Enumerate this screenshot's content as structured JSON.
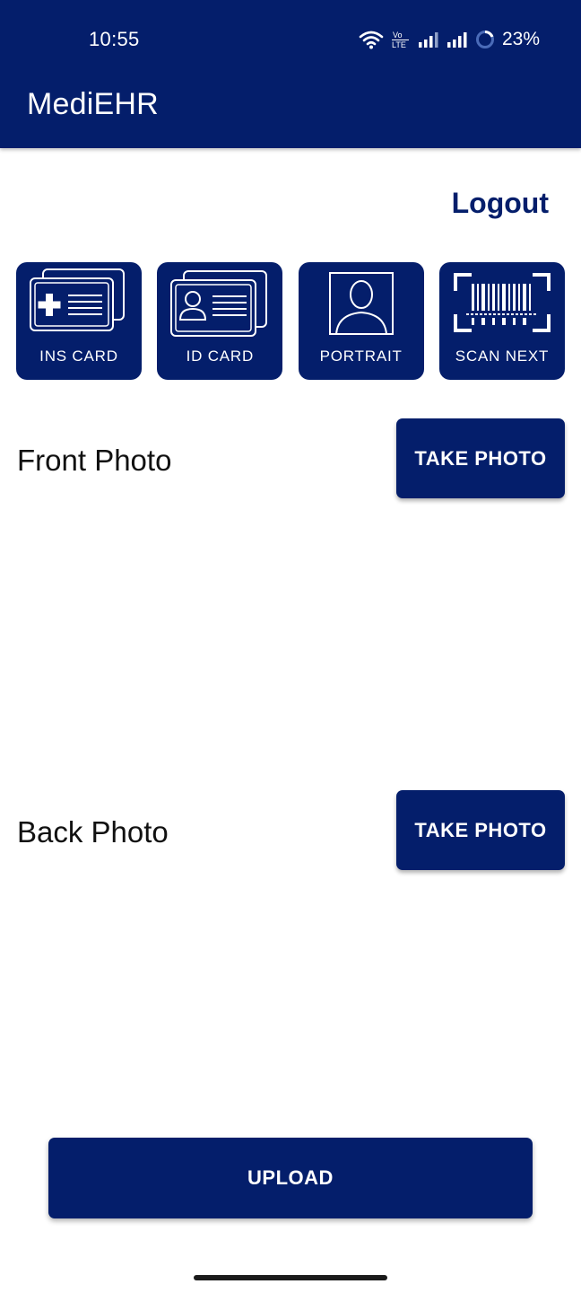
{
  "status_bar": {
    "time": "10:55",
    "battery": "23%",
    "icons": [
      "wifi-icon",
      "volte-icon",
      "signal-icon",
      "signal-icon",
      "battery-ring-icon"
    ]
  },
  "app": {
    "title": "MediEHR",
    "brand_color": "#041e6b"
  },
  "logout_label": "Logout",
  "tiles": [
    {
      "label": "INS CARD",
      "icon": "insurance-card-icon"
    },
    {
      "label": "ID CARD",
      "icon": "id-card-icon"
    },
    {
      "label": "PORTRAIT",
      "icon": "portrait-icon"
    },
    {
      "label": "SCAN NEXT",
      "icon": "barcode-scan-icon"
    }
  ],
  "front": {
    "label": "Front Photo",
    "button": "TAKE PHOTO"
  },
  "back": {
    "label": "Back Photo",
    "button": "TAKE PHOTO"
  },
  "upload_label": "UPLOAD"
}
